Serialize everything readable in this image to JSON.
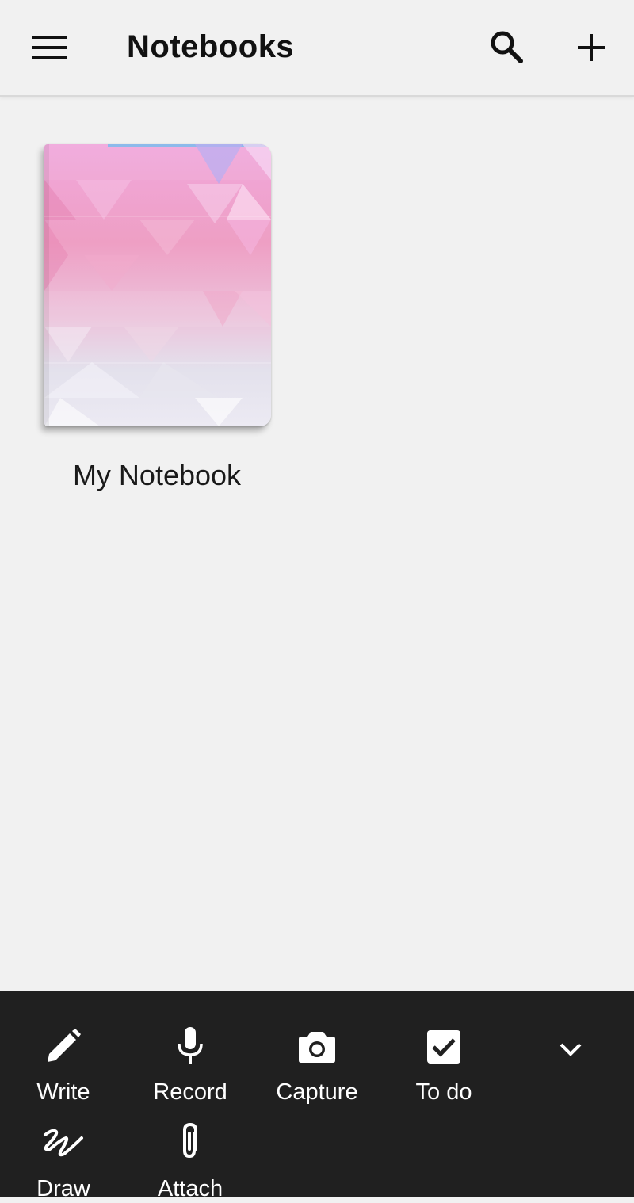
{
  "header": {
    "title": "Notebooks",
    "menu_icon": "menu-icon",
    "search_icon": "search-icon",
    "add_icon": "plus-icon"
  },
  "notebooks": [
    {
      "name": "My Notebook"
    }
  ],
  "toolbar": {
    "items": [
      {
        "label": "Write",
        "icon": "pencil-icon"
      },
      {
        "label": "Record",
        "icon": "microphone-icon"
      },
      {
        "label": "Capture",
        "icon": "camera-icon"
      },
      {
        "label": "To do",
        "icon": "checkbox-icon"
      },
      {
        "label": "Draw",
        "icon": "scribble-icon"
      },
      {
        "label": "Attach",
        "icon": "paperclip-icon"
      }
    ],
    "collapse_icon": "chevron-down-icon"
  },
  "colors": {
    "background": "#f1f1f1",
    "toolbar_background": "#202020",
    "toolbar_text": "#ffffff"
  }
}
